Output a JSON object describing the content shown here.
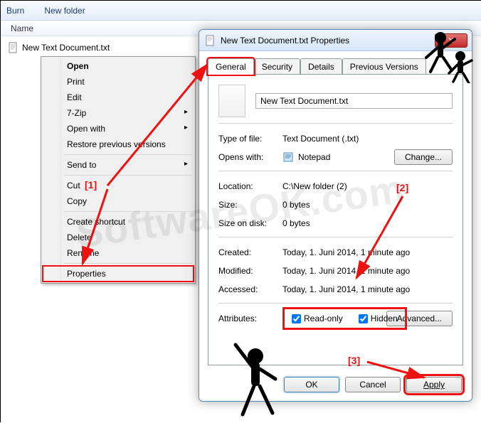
{
  "toolbar": {
    "burn": "Burn",
    "newfolder": "New folder"
  },
  "columns": {
    "name": "Name"
  },
  "file": {
    "name": "New Text Document.txt"
  },
  "contextmenu": {
    "open": "Open",
    "print": "Print",
    "edit": "Edit",
    "sevenzip": "7-Zip",
    "openwith": "Open with",
    "restore": "Restore previous versions",
    "sendto": "Send to",
    "cut": "Cut",
    "copy": "Copy",
    "createshortcut": "Create shortcut",
    "delete": "Delete",
    "rename": "Rename",
    "properties": "Properties"
  },
  "dialog": {
    "title": "New Text Document.txt Properties",
    "tabs": {
      "general": "General",
      "security": "Security",
      "details": "Details",
      "previous": "Previous Versions"
    },
    "nameval": "New Text Document.txt",
    "labels": {
      "typeoffile": "Type of file:",
      "openswith": "Opens with:",
      "location": "Location:",
      "size": "Size:",
      "sizeondisk": "Size on disk:",
      "created": "Created:",
      "modified": "Modified:",
      "accessed": "Accessed:",
      "attributes": "Attributes:"
    },
    "values": {
      "typeoffile": "Text Document (.txt)",
      "openswith": "Notepad",
      "location": "C:\\New folder (2)",
      "size": "0 bytes",
      "sizeondisk": "0 bytes",
      "created": "Today, 1. Juni 2014, 1 minute ago",
      "modified": "Today, 1. Juni 2014, 1 minute ago",
      "accessed": "Today, 1. Juni 2014, 1 minute ago"
    },
    "attrs": {
      "readonly": "Read-only",
      "hidden": "Hidden"
    },
    "buttons": {
      "change": "Change...",
      "advanced": "Advanced...",
      "ok": "OK",
      "cancel": "Cancel",
      "apply": "Apply"
    }
  },
  "callouts": {
    "one": "[1]",
    "two": "[2]",
    "three": "[3]"
  },
  "watermark": "SoftwareOK.com"
}
